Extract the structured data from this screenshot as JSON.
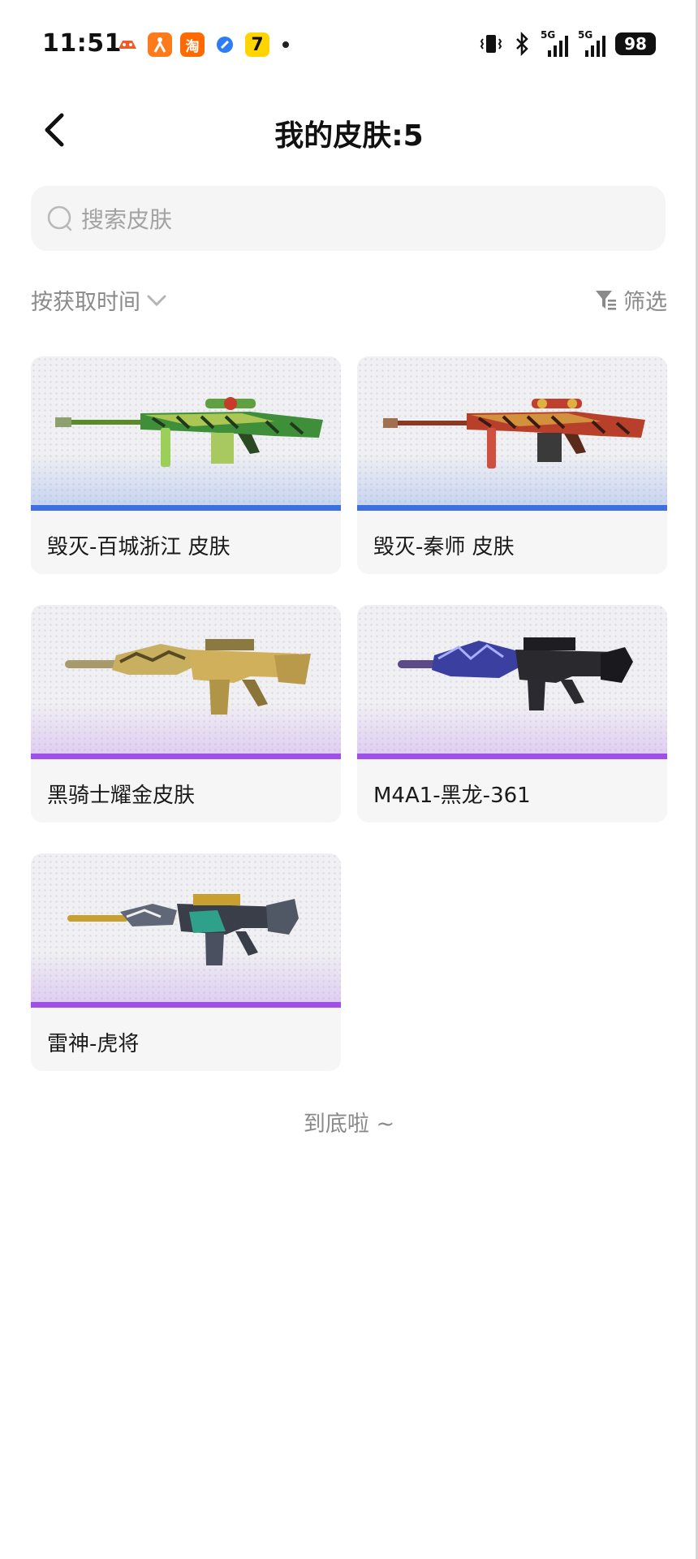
{
  "status_bar": {
    "time": "11:51",
    "notification_icons": [
      "game-icon",
      "delivery-icon",
      "taobao-icon",
      "browser-icon",
      "app-7-icon"
    ],
    "taobao_char": "淘",
    "network_1": "5G",
    "network_2": "5G",
    "battery": "98"
  },
  "header": {
    "title": "我的皮肤:5"
  },
  "search": {
    "placeholder": "搜索皮肤"
  },
  "toolbar": {
    "sort_label": "按获取时间",
    "filter_label": "筛选"
  },
  "skins": [
    {
      "name": "毁灭-百城浙江 皮肤",
      "rarity": "blue",
      "rarity_color": "#3d6fe0",
      "weapon": "sniper-rifle"
    },
    {
      "name": "毁灭-秦师 皮肤",
      "rarity": "blue",
      "rarity_color": "#3d6fe0",
      "weapon": "sniper-rifle"
    },
    {
      "name": "黑骑士耀金皮肤",
      "rarity": "purple",
      "rarity_color": "#a050e8",
      "weapon": "assault-rifle"
    },
    {
      "name": "M4A1-黑龙-361",
      "rarity": "purple",
      "rarity_color": "#a050e8",
      "weapon": "assault-rifle"
    },
    {
      "name": "雷神-虎将",
      "rarity": "purple",
      "rarity_color": "#a050e8",
      "weapon": "assault-rifle"
    }
  ],
  "footer": {
    "end_text": "到底啦 ~"
  }
}
